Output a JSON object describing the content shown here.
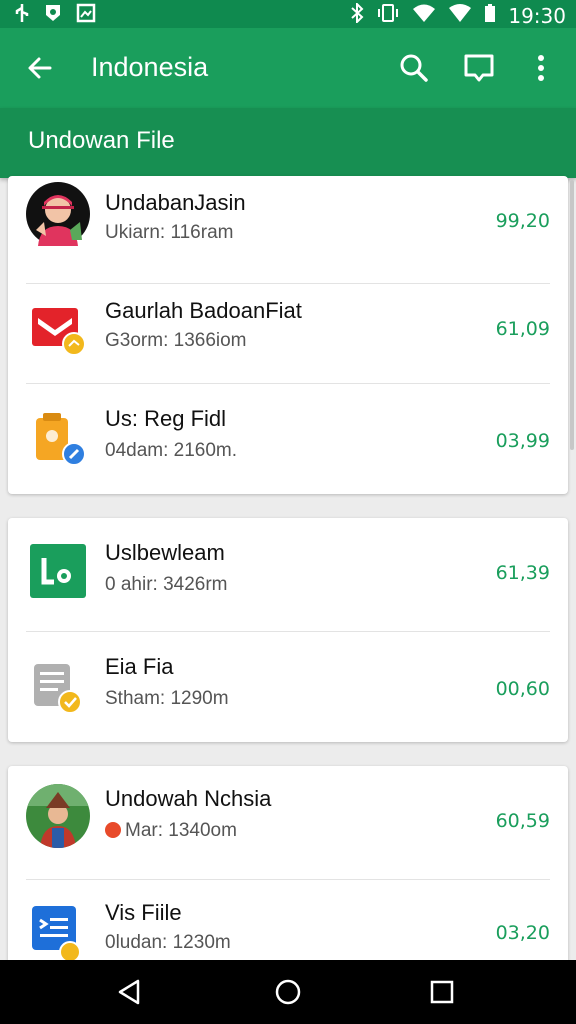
{
  "status_bar": {
    "time": "19:30",
    "left_icons": [
      "usb-icon",
      "shield-icon",
      "photo-icon"
    ],
    "right_icons": [
      "bluetooth-icon",
      "vibrate-icon",
      "wifi-icon",
      "signal-icon",
      "battery-icon"
    ]
  },
  "app_bar": {
    "title": "Indonesia",
    "back_icon": "arrow-back-icon",
    "actions": [
      "search-icon",
      "cast-icon",
      "more-vert-icon"
    ],
    "bg_color": "#1a9e5c"
  },
  "section_title": "Undowan File",
  "groups": [
    {
      "items": [
        {
          "name": "UndabanJasin",
          "meta": "Ukiarn: 116ram",
          "value": "99,20",
          "icon": "avatar-woman-icon"
        },
        {
          "name": "Gaurlah BadoanFiat",
          "meta": "G3orm: 1366iom",
          "value": "61,09",
          "icon": "mail-icon"
        },
        {
          "name": "Us: Reg Fidl",
          "meta": "04dam: 2160m.",
          "value": "03,99",
          "icon": "clipboard-icon"
        }
      ]
    },
    {
      "items": [
        {
          "name": "Uslbewleam",
          "meta": "0 ahir: 3426rm",
          "value": "61,39",
          "icon": "sheets-icon"
        },
        {
          "name": "Eia Fia",
          "meta": "Stham: 1290m",
          "value": "00,60",
          "icon": "document-icon"
        }
      ]
    },
    {
      "items": [
        {
          "name": "Undowah Nchsia",
          "meta": "Mar: 1340om",
          "value": "60,59",
          "icon": "avatar-man-icon"
        },
        {
          "name": "Vis Fiile",
          "meta": "0ludan: 1230m",
          "value": "03,20",
          "icon": "doc-list-icon"
        }
      ]
    }
  ],
  "nav_bar": {
    "buttons": [
      "back-triangle-icon",
      "home-circle-icon",
      "recents-square-icon"
    ]
  }
}
